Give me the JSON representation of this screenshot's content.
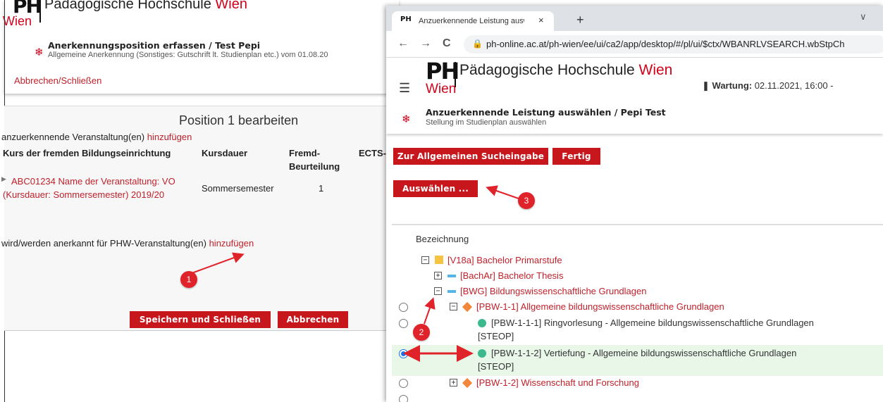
{
  "left_page": {
    "logo": {
      "mark": "PH",
      "title": "Pädagogische Hochschule",
      "title_red": "Wien",
      "wien": "Wien"
    },
    "header": {
      "title": "Anerkennungsposition erfassen",
      "title_suffix": " / Test Pepi",
      "subtitle": "Allgemeine Anerkennung (Sonstiges: Gutschrift lt. Studienplan etc.) vom 01.08.20"
    },
    "close_link": "Abbrechen/Schließen",
    "section_title": "Position 1 bearbeiten",
    "add_line_prefix": "anzuerkennende Veranstaltung(en) ",
    "add_line_link": "hinzufügen",
    "table": {
      "headers": [
        "Kurs der fremden Bildungseinrichtung",
        "Kursdauer",
        "Fremd-",
        "Beurteilung",
        "ECTS-"
      ],
      "row": {
        "course_line1": "ABC01234 Name der Veranstaltung: VO",
        "course_line2": "(Kursdauer: Sommersemester) 2019/20",
        "duration": "Sommersemester",
        "grade": "1"
      }
    },
    "recognized_prefix": "wird/werden anerkannt für PHW-Veranstaltung(en) ",
    "recognized_link": "hinzufügen",
    "buttons": {
      "save": "Speichern und Schließen",
      "cancel": "Abbrechen"
    },
    "badge_1": "1"
  },
  "browser": {
    "tab": {
      "favicon": "PH",
      "title": "Anzuerkennende Leistung auswä",
      "close": "×"
    },
    "new_tab": "+",
    "more": "∨",
    "nav": {
      "back": "←",
      "forward": "→",
      "reload": "C"
    },
    "url": "ph-online.ac.at/ph-wien/ee/ui/ca2/app/desktop/#/pl/ui/$ctx/WBANRLVSEARCH.wbStpCh",
    "logo": {
      "mark": "PH",
      "title": "Pädagogische Hochschule",
      "title_red": "Wien",
      "wien": "Wien"
    },
    "wartung_label": "Wartung:",
    "wartung_value": " 02.11.2021, 16:00 -",
    "header": {
      "title": "Anzuerkennende Leistung auswählen",
      "title_suffix": " / Pepi Test",
      "subtitle": "Stellung im Studienplan auswählen"
    },
    "buttons": {
      "search": "Zur Allgemeinen Sucheingabe",
      "done": "Fertig",
      "select": "Auswählen ..."
    },
    "badge_3": "3",
    "badge_2": "2",
    "tree_header": "Bezeichnung",
    "tree": [
      {
        "code": "[V18a] Bachelor Primarstufe",
        "icon": "yellow-square",
        "expand": "−"
      },
      {
        "code": "[BachAr] Bachelor Thesis",
        "icon": "blue-bar",
        "expand": "+"
      },
      {
        "code": "[BWG] Bildungswissenschaftliche Grundlagen",
        "icon": "blue-bar",
        "expand": "−"
      },
      {
        "code": "[PBW-1-1] Allgemeine bildungswissenschaftliche Grundlagen",
        "icon": "orange-diamond",
        "expand": "−"
      },
      {
        "line1": "[PBW-1-1-1] Ringvorlesung - Allgemeine bildungswissenschaftliche Grundlagen",
        "line2": "[STEOP]",
        "icon": "green-dot"
      },
      {
        "line1": "[PBW-1-1-2] Vertiefung - Allgemeine bildungswissenschaftliche Grundlagen",
        "line2": "[STEOP]",
        "icon": "green-dot",
        "selected": true
      },
      {
        "code": "[PBW-1-2] Wissenschaft und Forschung",
        "icon": "orange-diamond",
        "expand": "+"
      }
    ]
  },
  "colors": {
    "brand_red": "#c8161d",
    "link_red": "#c0212b",
    "selected_row": "#e8f7e8",
    "annotation_red": "#e0232a"
  }
}
